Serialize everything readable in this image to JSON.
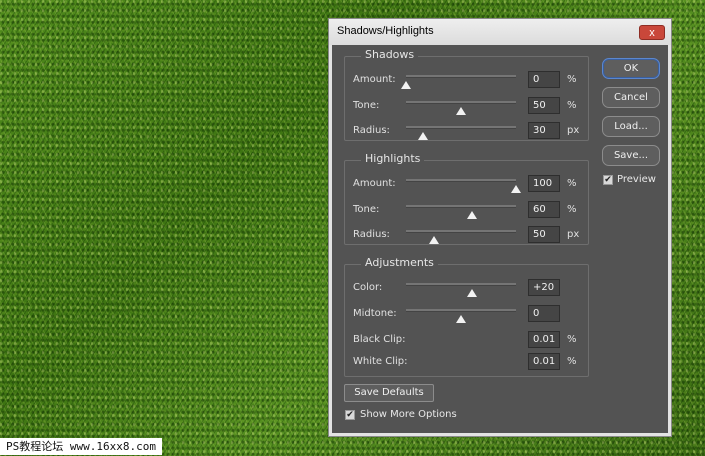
{
  "dialog": {
    "title": "Shadows/Highlights",
    "close_label": "x"
  },
  "shadows": {
    "legend": "Shadows",
    "rows": [
      {
        "label": "Amount:",
        "value": "0",
        "unit": "%",
        "slider_fraction": 0.0
      },
      {
        "label": "Tone:",
        "value": "50",
        "unit": "%",
        "slider_fraction": 0.5
      },
      {
        "label": "Radius:",
        "value": "30",
        "unit": "px",
        "slider_fraction": 0.15
      }
    ]
  },
  "highlights": {
    "legend": "Highlights",
    "rows": [
      {
        "label": "Amount:",
        "value": "100",
        "unit": "%",
        "slider_fraction": 1.0
      },
      {
        "label": "Tone:",
        "value": "60",
        "unit": "%",
        "slider_fraction": 0.6
      },
      {
        "label": "Radius:",
        "value": "50",
        "unit": "px",
        "slider_fraction": 0.25
      }
    ]
  },
  "adjustments": {
    "legend": "Adjustments",
    "color": {
      "label": "Color:",
      "value": "+20",
      "slider_fraction": 0.6
    },
    "midtone": {
      "label": "Midtone:",
      "value": "0",
      "slider_fraction": 0.5
    },
    "black_clip": {
      "label": "Black Clip:",
      "value": "0.01",
      "unit": "%"
    },
    "white_clip": {
      "label": "White Clip:",
      "value": "0.01",
      "unit": "%"
    }
  },
  "buttons": {
    "ok": "OK",
    "cancel": "Cancel",
    "load": "Load...",
    "save": "Save...",
    "save_defaults": "Save Defaults"
  },
  "preview": {
    "label": "Preview",
    "checked": true
  },
  "show_more": {
    "label": "Show More Options",
    "checked": true
  },
  "watermark": "PS教程论坛 www.16xx8.com"
}
